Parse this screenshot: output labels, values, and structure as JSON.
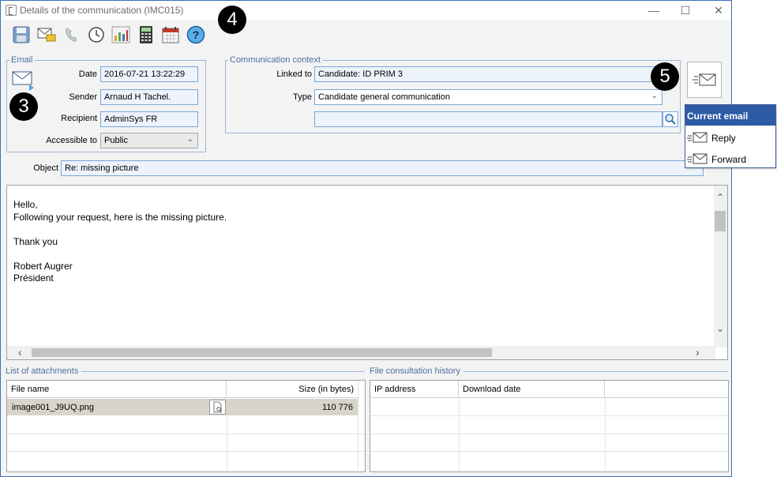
{
  "window": {
    "title": "Details of the communication (IMC015)",
    "minimize": "—",
    "maximize": "☐",
    "close": "✕"
  },
  "toolbar": {
    "icons": [
      "save-icon",
      "send-email-icon",
      "phone-icon",
      "history-icon",
      "chart-icon",
      "calculator-icon",
      "calendar-icon",
      "help-icon"
    ]
  },
  "email_group": {
    "title": "Email",
    "date_label": "Date",
    "date_value": "2016-07-21 13:22:29",
    "sender_label": "Sender",
    "sender_value": "Arnaud H Tachel.",
    "recipient_label": "Recipient",
    "recipient_value": "AdminSys FR",
    "accessible_label": "Accessible to",
    "accessible_value": "Public"
  },
  "context_group": {
    "title": "Communication context",
    "linked_label": "Linked to",
    "linked_value": "Candidate: ID PRIM 3",
    "type_label": "Type",
    "type_value": "Candidate general communication",
    "search_value": ""
  },
  "object": {
    "label": "Object",
    "value": "Re: missing picture"
  },
  "message": {
    "lines": [
      "Hello,",
      "Following your request, here is the missing picture.",
      "",
      "Thank you",
      "",
      "Robert Augrer",
      "Président"
    ]
  },
  "attachments": {
    "title": "List of attachments",
    "col_file": "File name",
    "col_size": "Size (in bytes)",
    "rows": [
      {
        "file": "image001_J9UQ.png",
        "size": "110 776"
      }
    ]
  },
  "history": {
    "title": "File consultation history",
    "col_ip": "IP address",
    "col_date": "Download date"
  },
  "menu": {
    "header": "Current email",
    "items": [
      "Reply",
      "Forward"
    ]
  },
  "badges": [
    "3",
    "4",
    "5"
  ],
  "colors": {
    "accent": "#2d5ba6",
    "field_border": "#7aa7d6",
    "field_bg": "#edf3fb",
    "selected_row": "#d8d4cc"
  }
}
